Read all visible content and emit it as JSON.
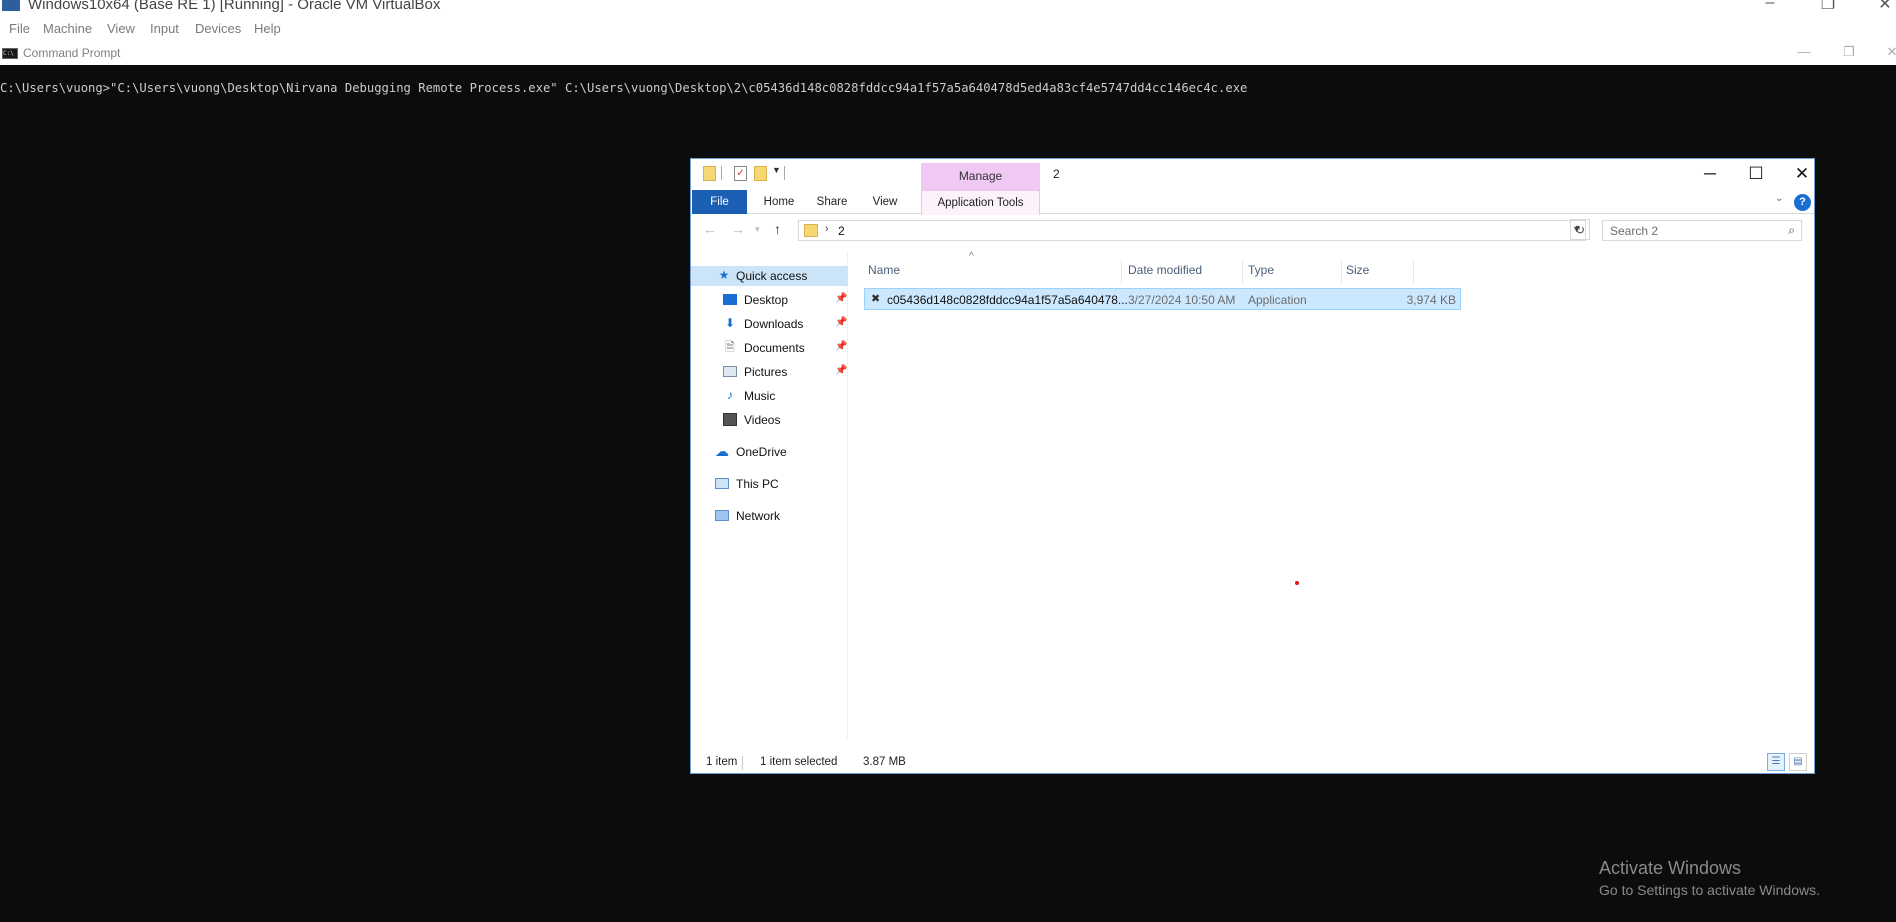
{
  "vbox": {
    "title": "Windows10x64 (Base RE 1) [Running] - Oracle VM VirtualBox",
    "menu": [
      "File",
      "Machine",
      "View",
      "Input",
      "Devices",
      "Help"
    ]
  },
  "cmd": {
    "title": "Command Prompt",
    "command_line": "C:\\Users\\vuong>\"C:\\Users\\vuong\\Desktop\\Nirvana Debugging Remote Process.exe\" C:\\Users\\vuong\\Desktop\\2\\c05436d148c0828fddcc94a1f57a5a640478d5ed4a83cf4e5747dd4cc146ec4c.exe"
  },
  "explorer": {
    "window_title": "2",
    "manage_tab": "Manage",
    "ribbon_tabs": {
      "file": "File",
      "home": "Home",
      "share": "Share",
      "view": "View",
      "app_tools": "Application Tools"
    },
    "address": {
      "crumb": "2"
    },
    "search_placeholder": "Search 2",
    "nav": {
      "quick_access": "Quick access",
      "desktop": "Desktop",
      "downloads": "Downloads",
      "documents": "Documents",
      "pictures": "Pictures",
      "music": "Music",
      "videos": "Videos",
      "onedrive": "OneDrive",
      "this_pc": "This PC",
      "network": "Network"
    },
    "columns": {
      "name": "Name",
      "date": "Date modified",
      "type": "Type",
      "size": "Size"
    },
    "files": [
      {
        "name": "c05436d148c0828fddcc94a1f57a5a640478...",
        "date": "3/27/2024 10:50 AM",
        "type": "Application",
        "size": "3,974 KB"
      }
    ],
    "status": {
      "count": "1 item",
      "selected": "1 item selected",
      "selected_size": "3.87 MB"
    }
  },
  "watermark": {
    "line1": "Activate Windows",
    "line2": "Go to Settings to activate Windows."
  },
  "colors": {
    "console_bg": "#0c0c0c",
    "console_text": "#cccccc",
    "file_tab": "#1a5fb4",
    "manage_tab": "#f0c8f4",
    "selection": "#cce8ff"
  }
}
